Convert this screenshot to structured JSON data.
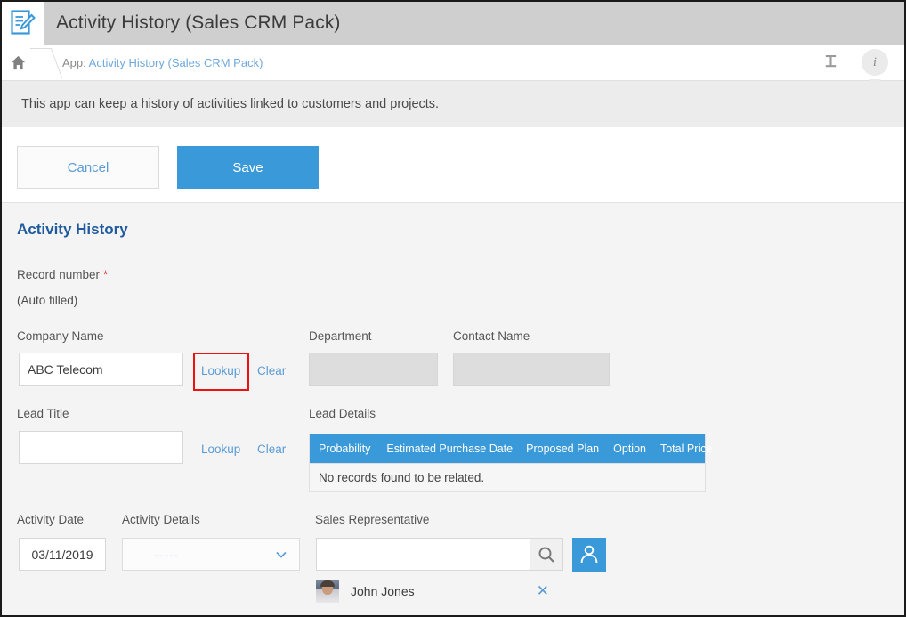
{
  "titlebar": {
    "app_icon": "document-edit-icon",
    "title": "Activity History (Sales CRM Pack)"
  },
  "breadcrumb": {
    "home_icon": "home-icon",
    "prefix": "App:",
    "link": "Activity History (Sales CRM Pack)",
    "pin_icon": "pin-icon",
    "info_icon": "info-icon",
    "info_glyph": "i"
  },
  "description": {
    "text": "This app can keep a history of activities linked to customers and projects."
  },
  "actions": {
    "cancel_label": "Cancel",
    "save_label": "Save"
  },
  "form": {
    "section_title": "Activity History",
    "record_number": {
      "label": "Record number",
      "required_marker": "*",
      "value": "(Auto filled)"
    },
    "company_name": {
      "label": "Company Name",
      "value": "ABC Telecom",
      "lookup_label": "Lookup",
      "clear_label": "Clear",
      "highlighted": true
    },
    "department": {
      "label": "Department",
      "value": "",
      "disabled": true
    },
    "contact_name": {
      "label": "Contact Name",
      "value": "",
      "disabled": true
    },
    "lead_title": {
      "label": "Lead Title",
      "value": "",
      "lookup_label": "Lookup",
      "clear_label": "Clear"
    },
    "lead_details": {
      "label": "Lead Details",
      "columns": [
        "Probability",
        "Estimated Purchase Date",
        "Proposed Plan",
        "Option",
        "Total Price"
      ],
      "rows": [],
      "empty_message": "No records found to be related."
    },
    "activity_date": {
      "label": "Activity Date",
      "value": "03/11/2019"
    },
    "activity_details": {
      "label": "Activity Details",
      "value": "-----",
      "chevron_icon": "chevron-down-icon"
    },
    "sales_representative": {
      "label": "Sales Representative",
      "search_value": "",
      "search_icon": "search-icon",
      "person_picker_icon": "person-icon",
      "selected": [
        {
          "name": "John Jones",
          "avatar": "user-avatar",
          "remove_icon": "close-icon"
        }
      ]
    }
  },
  "colors": {
    "accent_blue": "#3a9ad9",
    "link_blue": "#5b9bd5",
    "section_title_blue": "#1f5b9e",
    "required_red": "#e8463c",
    "highlight_red": "#ee1111",
    "titlebar_gray": "#cfcfcf",
    "description_gray": "#ececec",
    "form_bg_gray": "#f4f4f4",
    "disabled_gray": "#dddddd"
  }
}
